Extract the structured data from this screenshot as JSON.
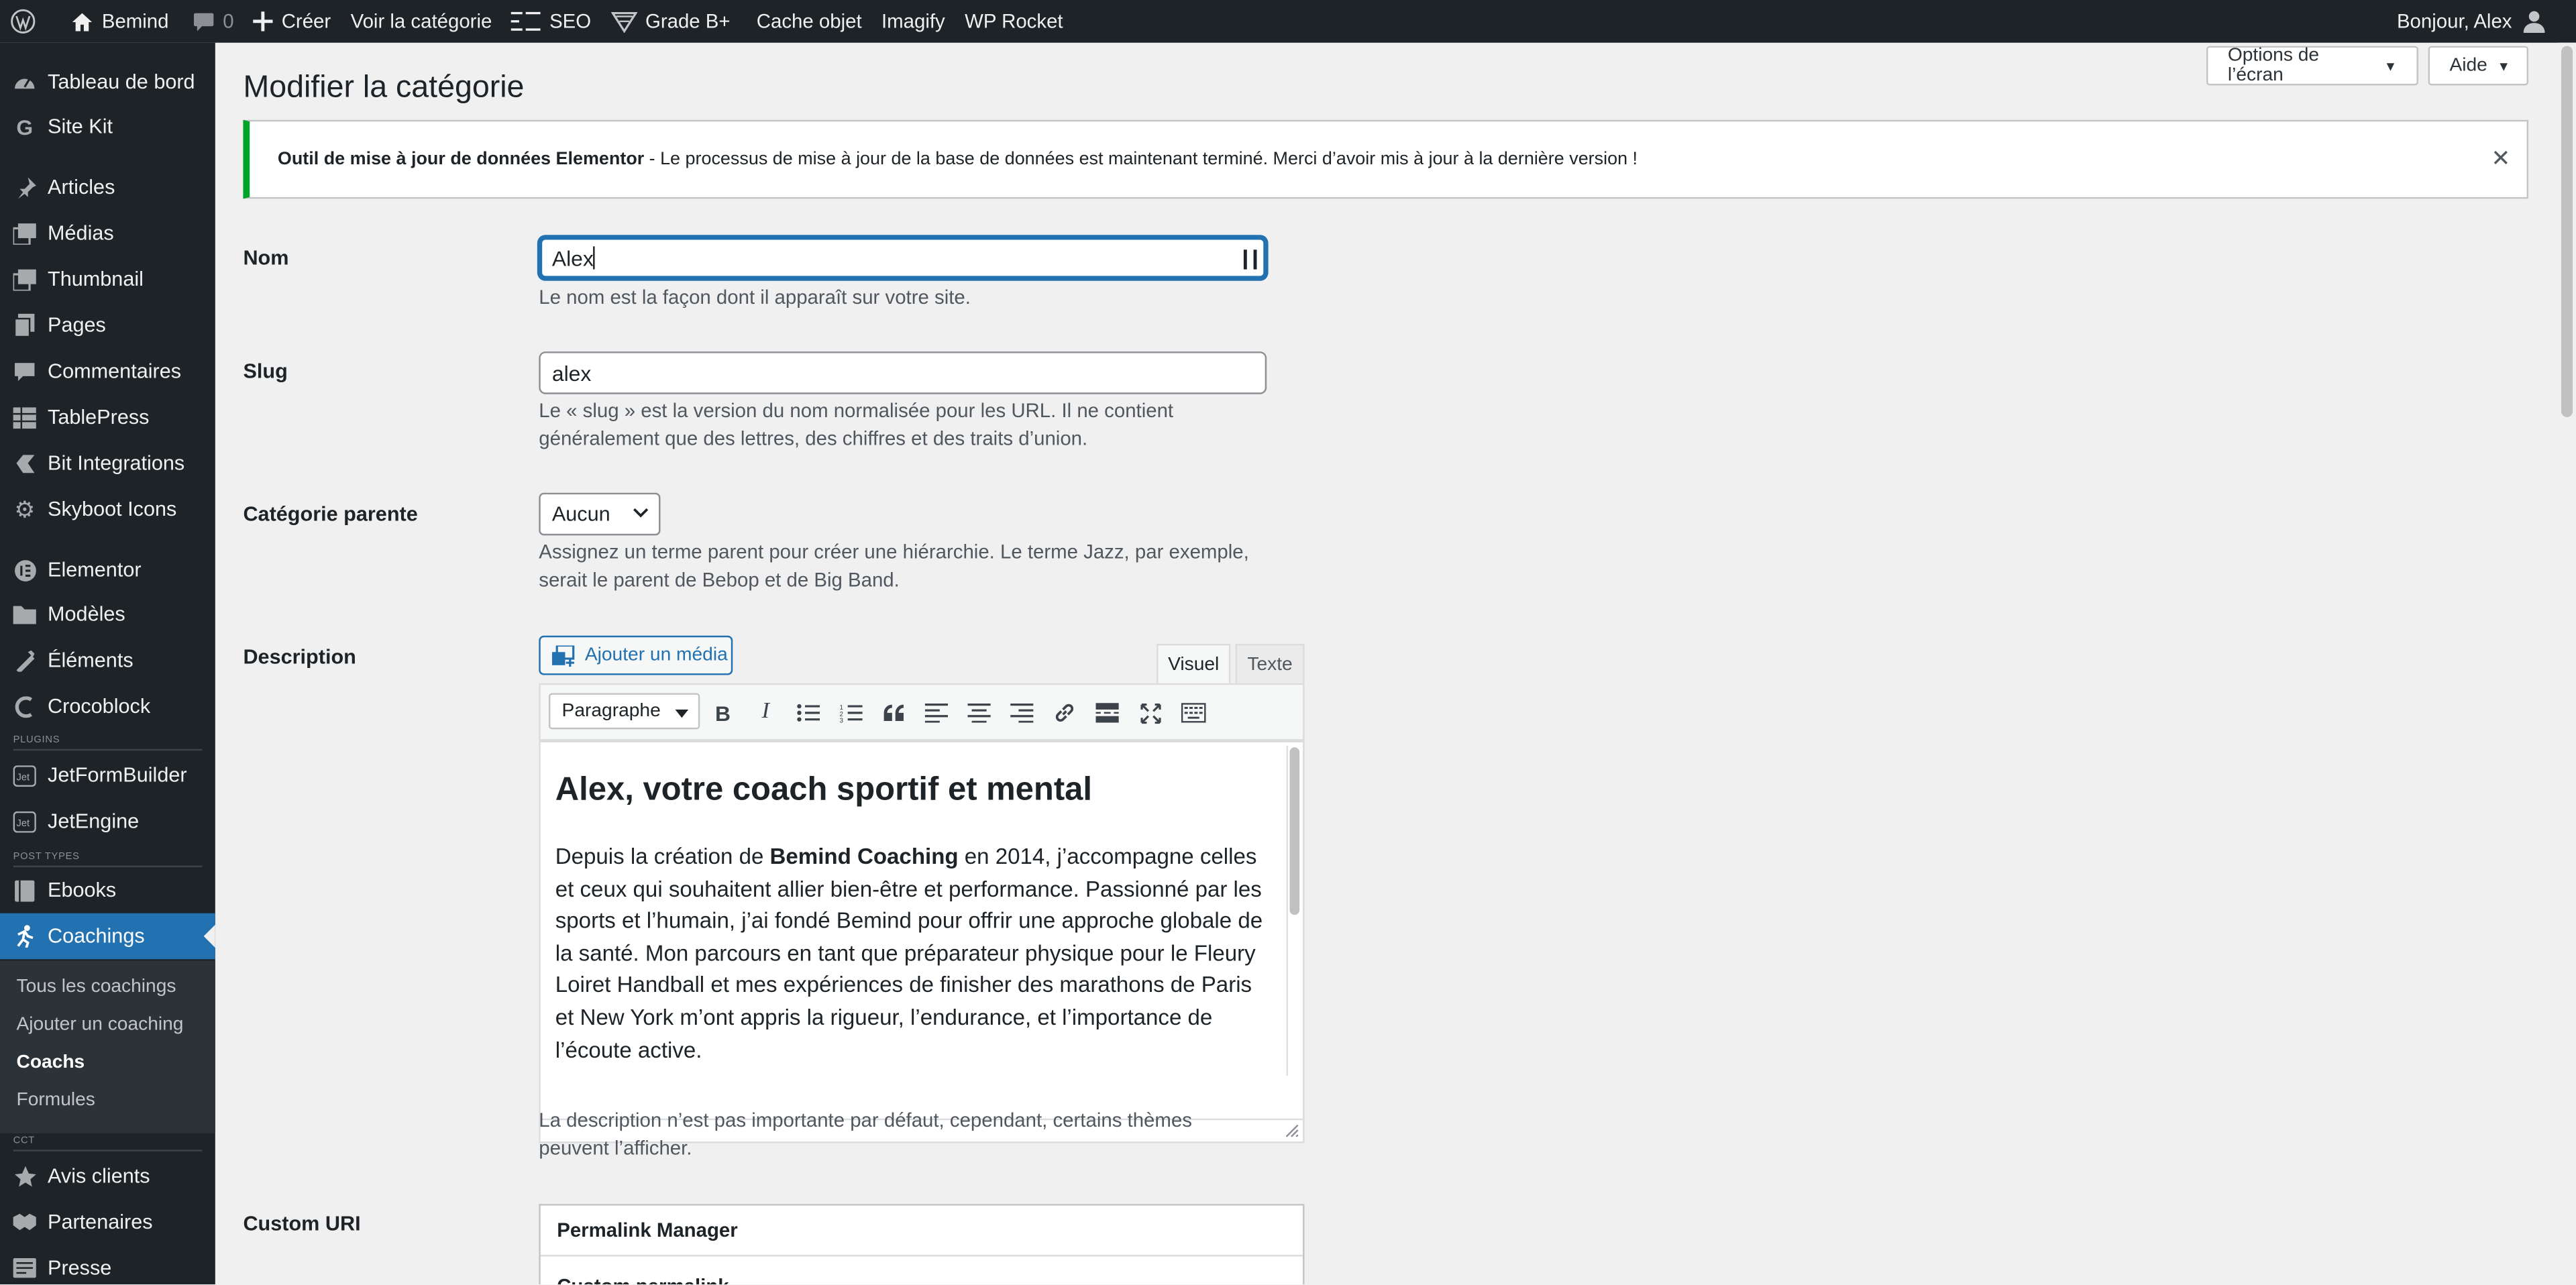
{
  "adminbar": {
    "site_name": "Bemind",
    "comments_count": "0",
    "new_label": "Créer",
    "view_category": "Voir la catégorie",
    "seo": "SEO",
    "grade": "Grade B+",
    "cache": "Cache objet",
    "imagify": "Imagify",
    "wprocket": "WP Rocket",
    "greeting": "Bonjour, Alex"
  },
  "sidebar": {
    "dashboard": "Tableau de bord",
    "sitekit": "Site Kit",
    "articles": "Articles",
    "medias": "Médias",
    "thumbnail": "Thumbnail",
    "pages": "Pages",
    "comments": "Commentaires",
    "tablepress": "TablePress",
    "bitintegrations": "Bit Integrations",
    "skyboot": "Skyboot Icons",
    "elementor": "Elementor",
    "modeles": "Modèles",
    "elements": "Éléments",
    "crocoblock": "Crocoblock",
    "sep_plugins": "PLUGINS",
    "jetformbuilder": "JetFormBuilder",
    "jetengine": "JetEngine",
    "sep_posttypes": "POST TYPES",
    "ebooks": "Ebooks",
    "coachings": "Coachings",
    "sub_all": "Tous les coachings",
    "sub_add": "Ajouter un coaching",
    "sub_coachs": "Coachs",
    "sub_formules": "Formules",
    "sep_cct": "CCT",
    "avis": "Avis clients",
    "partenaires": "Partenaires",
    "presse": "Presse"
  },
  "header": {
    "title": "Modifier la catégorie",
    "screen_options": "Options de l’écran",
    "help": "Aide"
  },
  "notice": {
    "strong": "Outil de mise à jour de données Elementor",
    "text": "- Le processus de mise à jour de la base de données est maintenant terminé. Merci d’avoir mis à jour à la dernière version !",
    "dismiss": "✕"
  },
  "form": {
    "name_label": "Nom",
    "name_value": "Alex",
    "name_hint": "Le nom est la façon dont il apparaît sur votre site.",
    "slug_label": "Slug",
    "slug_value": "alex",
    "slug_hint_1": "Le « slug » est la version du nom normalisée pour les URL. Il ne contient",
    "slug_hint_2": "généralement que des lettres, des chiffres et des traits d’union.",
    "parent_label": "Catégorie parente",
    "parent_value": "Aucun",
    "parent_hint_1": "Assignez un terme parent pour créer une hiérarchie. Le terme Jazz, par exemple,",
    "parent_hint_2": "serait le parent de Bebop et de Big Band.",
    "desc_label": "Description",
    "desc_hint_1": "La description n’est pas importante par défaut, cependant, certains thèmes",
    "desc_hint_2": "peuvent l’afficher.",
    "custom_uri_label": "Custom URI"
  },
  "editor": {
    "add_media": "Ajouter un média",
    "tab_visual": "Visuel",
    "tab_text": "Texte",
    "format": "Paragraphe",
    "heading": "Alex, votre coach sportif et mental",
    "p_before": "Depuis la création de ",
    "p_bold": "Bemind Coaching",
    "p_after": " en 2014, j’accompagne celles et ceux qui souhaitent allier bien-être et performance. Passionné par les sports et l’humain, j’ai fondé Bemind pour offrir une approche globale de la santé. Mon parcours en tant que préparateur physique pour le Fleury Loiret Handball et mes expériences de finisher des marathons de Paris et New York m’ont appris la rigueur, l’endurance, et l’importance de l’écoute active."
  },
  "permalink": {
    "title": "Permalink Manager",
    "custom": "Custom permalink"
  }
}
